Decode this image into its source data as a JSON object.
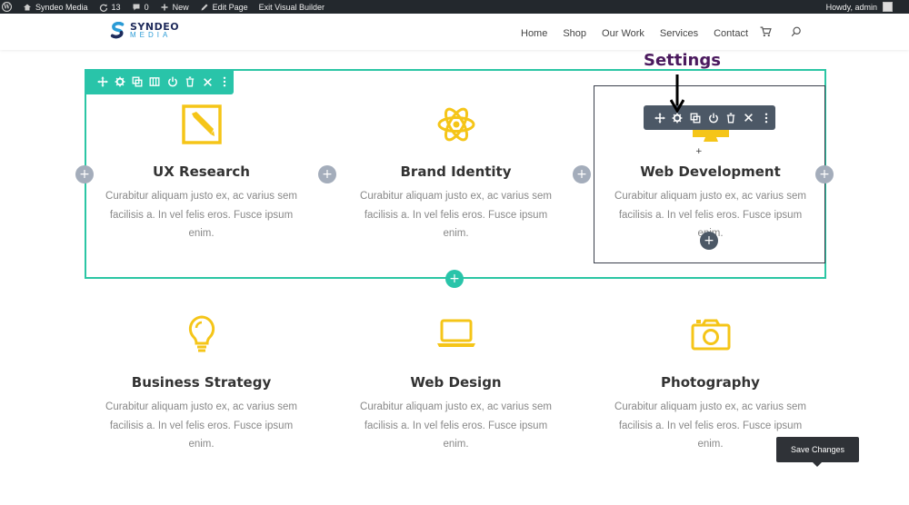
{
  "admin_bar": {
    "site_name": "Syndeo Media",
    "updates_count": "13",
    "comments_count": "0",
    "new_label": "New",
    "edit_page_label": "Edit Page",
    "exit_builder_label": "Exit Visual Builder",
    "howdy_label": "Howdy, admin"
  },
  "header": {
    "logo_main": "SYNDEO",
    "logo_sub": "MEDIA",
    "nav": [
      {
        "label": "Home"
      },
      {
        "label": "Shop"
      },
      {
        "label": "Our Work"
      },
      {
        "label": "Services"
      },
      {
        "label": "Contact"
      }
    ]
  },
  "annotation": {
    "settings_label": "Settings"
  },
  "blurbs": [
    {
      "title": "UX Research",
      "icon": "pencil-square-icon",
      "body": "Curabitur aliquam justo ex, ac varius sem facilisis a. In vel felis eros. Fusce ipsum enim."
    },
    {
      "title": "Brand Identity",
      "icon": "atom-icon",
      "body": "Curabitur aliquam justo ex, ac varius sem facilisis a. In vel felis eros. Fusce ipsum enim."
    },
    {
      "title": "Web Development",
      "icon": "monitor-icon",
      "body": "Curabitur aliquam justo ex, ac varius sem facilisis a. In vel felis eros. Fusce ipsum enim."
    },
    {
      "title": "Business Strategy",
      "icon": "lightbulb-icon",
      "body": "Curabitur aliquam justo ex, ac varius sem facilisis a. In vel felis eros. Fusce ipsum enim."
    },
    {
      "title": "Web Design",
      "icon": "laptop-icon",
      "body": "Curabitur aliquam justo ex, ac varius sem facilisis a. In vel felis eros. Fusce ipsum enim."
    },
    {
      "title": "Photography",
      "icon": "camera-icon",
      "body": "Curabitur aliquam justo ex, ac varius sem facilisis a. In vel felis eros. Fusce ipsum enim."
    }
  ],
  "save_button_label": "Save Changes",
  "colors": {
    "accent_teal": "#29c4a9",
    "icon_yellow": "#f5c518",
    "toolbar_dark": "#4c5866",
    "admin_bar": "#23282d",
    "annotation_purple": "#4b1a5e"
  }
}
